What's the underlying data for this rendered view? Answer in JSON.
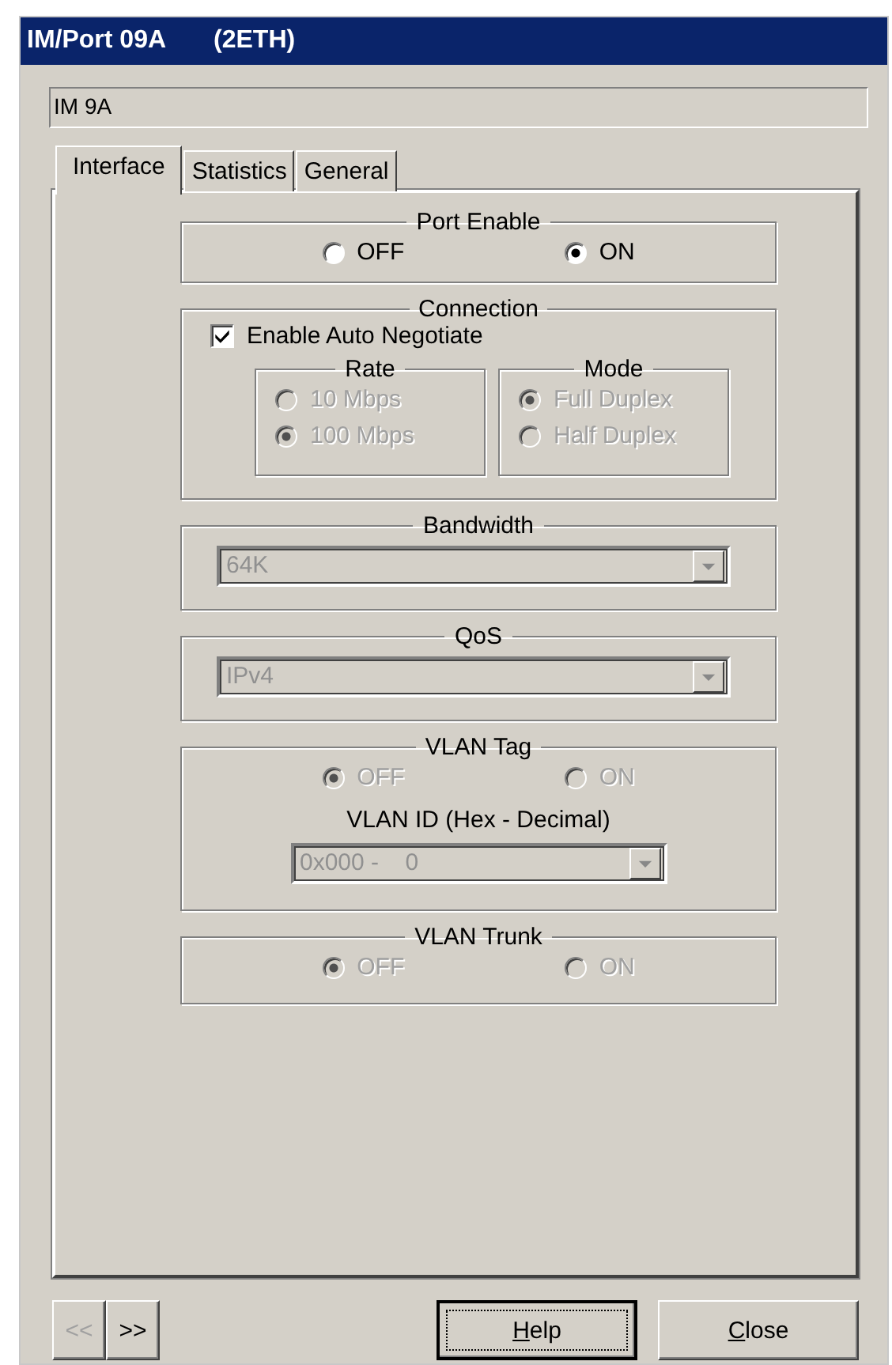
{
  "window": {
    "title": "IM/Port 09A",
    "subtitle": "(2ETH)"
  },
  "name_field": {
    "value": "IM 9A"
  },
  "tabs": [
    {
      "label": "Interface",
      "selected": true
    },
    {
      "label": "Statistics",
      "selected": false
    },
    {
      "label": "General",
      "selected": false
    }
  ],
  "port_enable": {
    "title": "Port Enable",
    "disabled": false,
    "options": [
      {
        "label": "OFF",
        "selected": false
      },
      {
        "label": "ON",
        "selected": true
      }
    ]
  },
  "connection": {
    "title": "Connection",
    "auto_negotiate": {
      "label": "Enable Auto Negotiate",
      "checked": true
    },
    "rate": {
      "title": "Rate",
      "disabled": true,
      "options": [
        {
          "label": "10 Mbps",
          "selected": false
        },
        {
          "label": "100 Mbps",
          "selected": true
        }
      ]
    },
    "mode": {
      "title": "Mode",
      "disabled": true,
      "options": [
        {
          "label": "Full Duplex",
          "selected": true
        },
        {
          "label": "Half Duplex",
          "selected": false
        }
      ]
    }
  },
  "bandwidth": {
    "title": "Bandwidth",
    "value": "64K",
    "disabled": true
  },
  "qos": {
    "title": "QoS",
    "value": "IPv4",
    "disabled": true
  },
  "vlan_tag": {
    "title": "VLAN Tag",
    "disabled": true,
    "options": [
      {
        "label": "OFF",
        "selected": true
      },
      {
        "label": "ON",
        "selected": false
      }
    ],
    "id_label": "VLAN ID (Hex - Decimal)",
    "id_value": "0x000 -    0"
  },
  "vlan_trunk": {
    "title": "VLAN Trunk",
    "disabled": true,
    "options": [
      {
        "label": "OFF",
        "selected": true
      },
      {
        "label": "ON",
        "selected": false
      }
    ]
  },
  "nav_buttons": [
    {
      "label": "<<",
      "disabled": true
    },
    {
      "label": ">>",
      "disabled": false
    }
  ],
  "buttons": [
    {
      "label": "Help",
      "default": true
    },
    {
      "label": "Close",
      "default": false
    }
  ]
}
